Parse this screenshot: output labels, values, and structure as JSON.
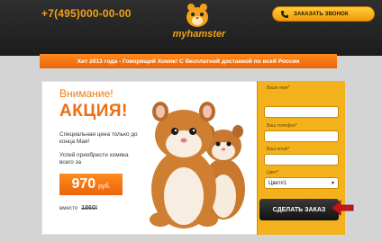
{
  "header": {
    "phone": "+7(495)000-00-00",
    "logo_text": "myhamster",
    "call_button": "ЗАКАЗАТЬ ЗВОНОК"
  },
  "banner": {
    "text": "Хит 2013 года - Говорящий Хомяк! С бесплатной доставкой по всей России"
  },
  "offer": {
    "attention": "Внимание!",
    "action": "АКЦИЯ!",
    "special": "Специальная цена только до конца Мая!",
    "buy_text": "Успей приобрести хомяка всего за",
    "price": "970",
    "currency": "руб.",
    "instead_label": "вместо",
    "old_price": "1860!"
  },
  "form": {
    "name_label": "Ваше имя*",
    "phone_label": "Ваш телефон*",
    "email_label": "Ваш email*",
    "color_label": "Цвет*",
    "color_value": "Цвет#1",
    "submit": "СДЕЛАТЬ ЗАКАЗ"
  },
  "colors": {
    "accent": "#f2a21a",
    "orange": "#ee6d10",
    "form_bg": "#f3b21c"
  }
}
